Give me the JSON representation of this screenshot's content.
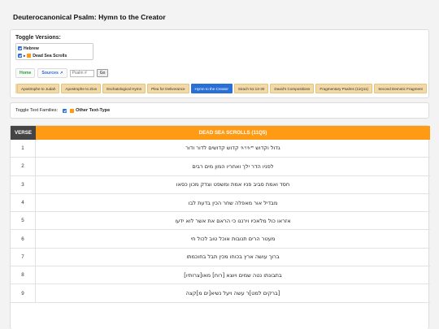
{
  "page": {
    "title": "Deuterocanonical Psalm: Hymn to the Creator"
  },
  "versions": {
    "title": "Toggle Versions:",
    "items": [
      {
        "label": "Hebrew",
        "checked": true
      },
      {
        "label": "Dead Sea Scrolls",
        "checked": true,
        "color": "#ff9a14",
        "arrow": "▸"
      }
    ]
  },
  "nav": {
    "home": "Home",
    "sources": "Sources ↗",
    "psalm_placeholder": "Psalm #",
    "go": "Go"
  },
  "tabs": [
    {
      "label": "Apostrophe to Judah",
      "active": false
    },
    {
      "label": "Apostrophe to Zion",
      "active": false
    },
    {
      "label": "Eschatological Hymn",
      "active": false
    },
    {
      "label": "Plea for Deliverance",
      "active": false
    },
    {
      "label": "Hymn to the Creator",
      "active": true
    },
    {
      "label": "Sirach 51:13-30",
      "active": false
    },
    {
      "label": "David's Compositions",
      "active": false
    },
    {
      "label": "Fragmentary Psalms (11Q11)",
      "active": false
    },
    {
      "label": "Second Demotic Fragment",
      "active": false
    }
  ],
  "families": {
    "label": "Toggle Text Families:",
    "item": "Other Text-Type",
    "checked": true,
    "color": "#ff9a14"
  },
  "table": {
    "headers": {
      "verse": "VERSE",
      "dss": "DEAD SEA SCROLLS (11Q5)"
    },
    "colors": {
      "verse_header": "#444444",
      "dss_header": "#ff9a14"
    },
    "rows": [
      {
        "verse": "1",
        "text": "גדול וקדוש 𐤉𐤄𐤅𐤄 קדוש קדושים לדור ודור"
      },
      {
        "verse": "2",
        "text": "לפניו הדר ילך ואחריו המון מים רבים"
      },
      {
        "verse": "3",
        "text": "חסד ואמת סביב פניו אמת ומשפט וצדק מכון כסאו"
      },
      {
        "verse": "4",
        "text": "מבדיל אור מאפלה שחר הכין בדעת לבו"
      },
      {
        "verse": "5",
        "text": "אזראו כול מלאכיו וירננו כי הראם את אשר לוא ידעו"
      },
      {
        "verse": "6",
        "text": "מעטר הרים תנובות אוכל טוב לכול חי"
      },
      {
        "verse": "7",
        "text": "ברוך עושה ארץ בכוחו מכין תבל בחוכמתו"
      },
      {
        "verse": "8",
        "text": "בתבונתו נטה שמים ויוצא [רוח] מאו[צרותיו]"
      },
      {
        "verse": "9",
        "text": "[ברקים למט]ר עשה ויעל נשיא[ים מ]קצה"
      }
    ]
  }
}
